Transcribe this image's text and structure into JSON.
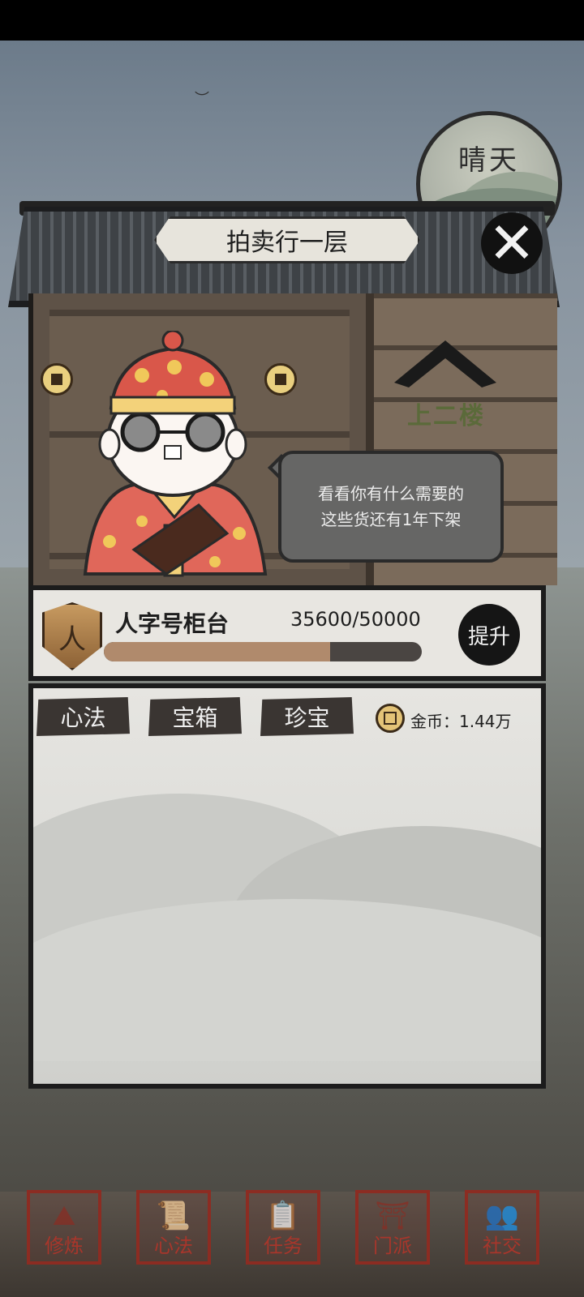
{
  "weather": {
    "label": "晴天"
  },
  "header": {
    "title": "拍卖行一层",
    "close_icon": "close-icon"
  },
  "stairs": {
    "label": "上二楼"
  },
  "npc": {
    "dialog_line1": "看看你有什么需要的",
    "dialog_line2": "这些货还有1年下架"
  },
  "counter": {
    "badge_char": "人",
    "name": "人字号柜台",
    "progress_text": "35600/50000",
    "progress_value": 0.712,
    "upgrade_label": "提升"
  },
  "tabs": [
    {
      "label": "心法"
    },
    {
      "label": "宝箱"
    },
    {
      "label": "珍宝"
    }
  ],
  "gold": {
    "label": "金币：1.44万"
  },
  "nav": [
    {
      "label": "修炼"
    },
    {
      "label": "心法"
    },
    {
      "label": "任务"
    },
    {
      "label": "门派"
    },
    {
      "label": "社交"
    }
  ],
  "colors": {
    "accent_red": "#8c2c22",
    "progress_fill": "#b08a6c",
    "panel_bg": "#e8e6e1"
  }
}
